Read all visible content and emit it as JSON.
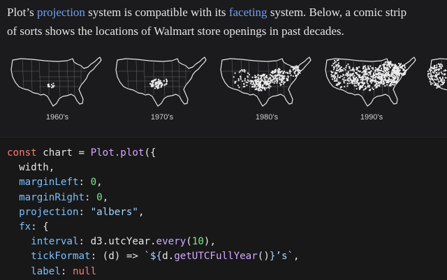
{
  "prose": {
    "t1": "Plot’s ",
    "link1": "projection",
    "t2": " system is compatible with its ",
    "link2": "faceting",
    "t3": " system. Below, a comic strip",
    "line2": "of sorts shows the locations of Walmart store openings in past decades."
  },
  "facets": [
    {
      "label": "1960’s"
    },
    {
      "label": "1970’s"
    },
    {
      "label": "1980’s"
    },
    {
      "label": "1990’s"
    }
  ],
  "code": {
    "l1": {
      "kw": "const",
      "a": " chart = ",
      "fn": "Plot.plot",
      "b": "({"
    },
    "l2": {
      "a": "  width,"
    },
    "l3": {
      "prop": "  marginLeft",
      "a": ": ",
      "num": "0",
      "b": ","
    },
    "l4": {
      "prop": "  marginRight",
      "a": ": ",
      "num": "0",
      "b": ","
    },
    "l5": {
      "prop": "  projection",
      "a": ": ",
      "str": "\"albers\"",
      "b": ","
    },
    "l6": {
      "prop": "  fx",
      "a": ": {"
    },
    "l7": {
      "prop": "    interval",
      "a": ": d3.utcYear.",
      "fn": "every",
      "b": "(",
      "num": "10",
      "c": "),"
    },
    "l8": {
      "prop": "    tickFormat",
      "a": ": (d) => ",
      "str1": "`${",
      "b": "d.",
      "fn": "getUTCFullYear",
      "c": "()",
      "str2": "}’s`",
      "d": ","
    },
    "l9": {
      "prop": "    label",
      "a": ": ",
      "kw": "null"
    }
  },
  "colors": {
    "background": "#1b1b1d",
    "link": "#6ea0f0",
    "dots": "#ececec"
  }
}
